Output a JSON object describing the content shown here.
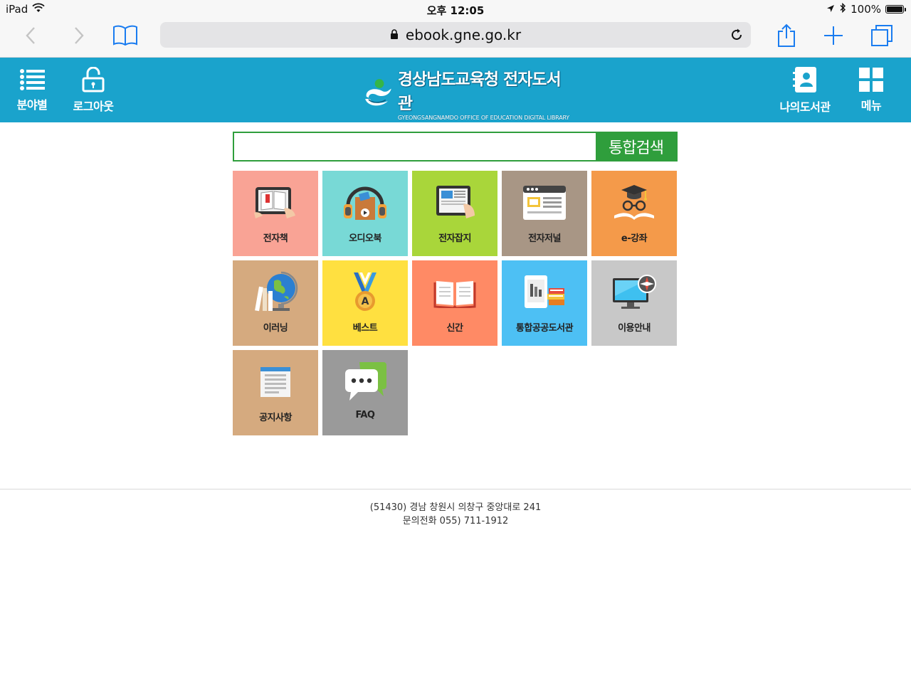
{
  "status_bar": {
    "device": "iPad",
    "time": "오후 12:05",
    "battery": "100%",
    "battery_level": 1.0
  },
  "browser": {
    "url": "ebook.gne.go.kr"
  },
  "header": {
    "left_buttons": [
      {
        "label": "분야별",
        "icon": "list-icon"
      },
      {
        "label": "로그아웃",
        "icon": "unlock-icon"
      }
    ],
    "logo_title": "경상남도교육청 전자도서관",
    "logo_subtitle": "GYEONGSANGNAMDO OFFICE OF EDUCATION DIGITAL LIBRARY",
    "right_buttons": [
      {
        "label": "나의도서관",
        "icon": "contact-book-icon"
      },
      {
        "label": "메뉴",
        "icon": "grid-menu-icon"
      }
    ]
  },
  "search": {
    "value": "",
    "placeholder": "",
    "button_label": "통합검색"
  },
  "tiles": [
    {
      "label": "전자책",
      "color": "#f9a395",
      "icon": "tablet-book-icon"
    },
    {
      "label": "오디오북",
      "color": "#78d9d6",
      "icon": "headphones-icon"
    },
    {
      "label": "전자잡지",
      "color": "#a9d63a",
      "icon": "tablet-magazine-icon"
    },
    {
      "label": "전자저널",
      "color": "#a89685",
      "icon": "browser-window-icon"
    },
    {
      "label": "e-강좌",
      "color": "#f49a4a",
      "icon": "graduation-cap-icon"
    },
    {
      "label": "이러닝",
      "color": "#d5aa7f",
      "icon": "globe-icon"
    },
    {
      "label": "베스트",
      "color": "#ffe040",
      "icon": "medal-icon"
    },
    {
      "label": "신간",
      "color": "#ff8a65",
      "icon": "open-book-icon"
    },
    {
      "label": "통합공공도서관",
      "color": "#4dc0f4",
      "icon": "library-books-icon"
    },
    {
      "label": "이용안내",
      "color": "#c8c8c8",
      "icon": "monitor-compass-icon"
    },
    {
      "label": "공지사항",
      "color": "#d5aa7f",
      "icon": "notice-board-icon"
    },
    {
      "label": "FAQ",
      "color": "#9a9a9a",
      "icon": "chat-bubble-icon"
    }
  ],
  "footer": {
    "address": "(51430) 경남 창원시 의창구 중앙대로 241",
    "phone": "문의전화 055) 711-1912"
  }
}
